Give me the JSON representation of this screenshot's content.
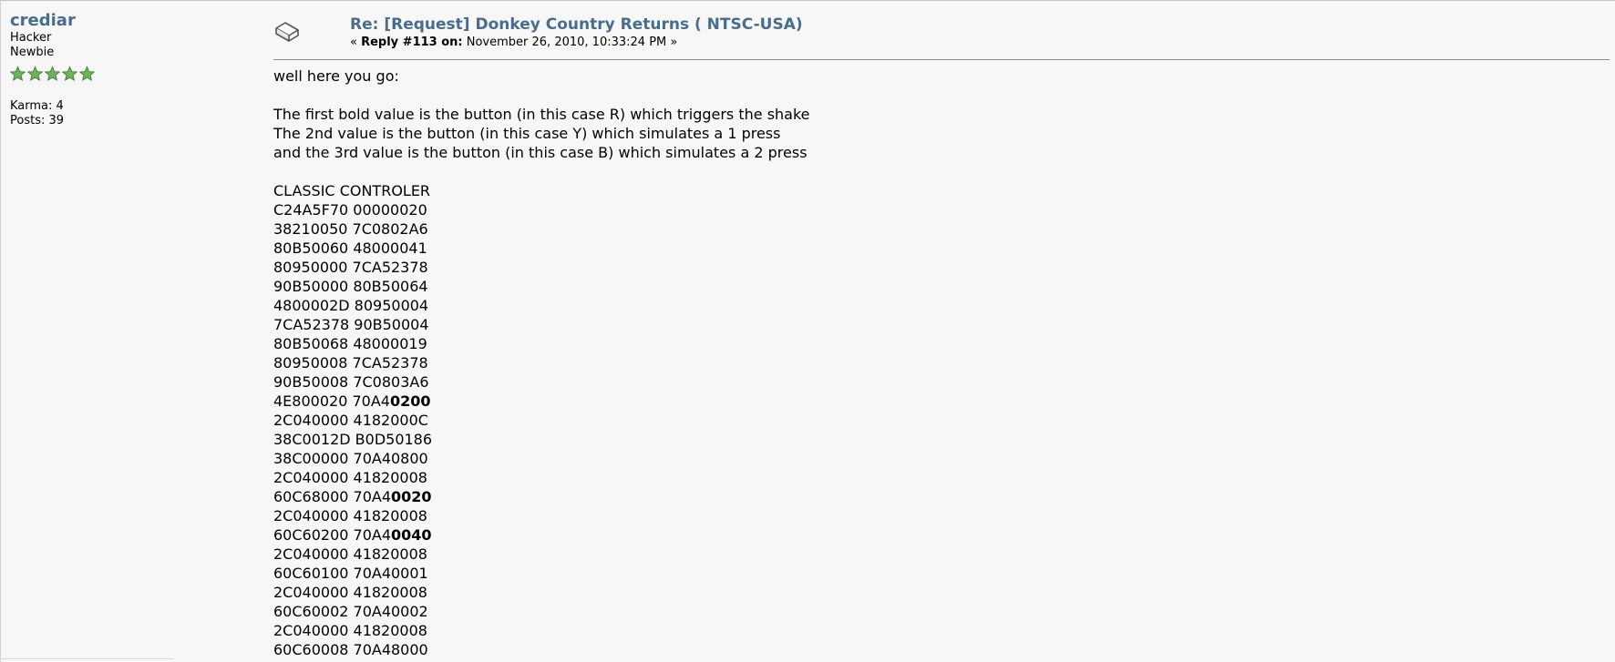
{
  "poster": {
    "name": "crediar",
    "title": "Hacker",
    "rank": "Newbie",
    "stars": 5,
    "star_icon": "star-icon",
    "karma": "Karma: 4",
    "posts": "Posts: 39"
  },
  "post": {
    "icon": "xx-post-icon",
    "subject": "Re: [Request] Donkey Country Returns ( NTSC-USA)",
    "reply_prefix": "« ",
    "reply_label": "Reply #113 on:",
    "reply_date": " November 26, 2010, 10:33:24 PM »",
    "intro": "well here you go:",
    "explain": [
      "The first bold value is the button (in this case R) which triggers the shake",
      "The 2nd value is the button (in this case Y) which simulates a 1 press",
      "and the 3rd value is the button (in this case B) which simulates a 2 press"
    ],
    "code_title": "CLASSIC CONTROLER",
    "code_lines": [
      {
        "text": "C24A5F70 00000020",
        "bold": ""
      },
      {
        "text": "38210050 7C0802A6",
        "bold": ""
      },
      {
        "text": "80B50060 48000041",
        "bold": ""
      },
      {
        "text": "80950000 7CA52378",
        "bold": ""
      },
      {
        "text": "90B50000 80B50064",
        "bold": ""
      },
      {
        "text": "4800002D 80950004",
        "bold": ""
      },
      {
        "text": "7CA52378 90B50004",
        "bold": ""
      },
      {
        "text": "80B50068 48000019",
        "bold": ""
      },
      {
        "text": "80950008 7CA52378",
        "bold": ""
      },
      {
        "text": "90B50008 7C0803A6",
        "bold": ""
      },
      {
        "text": "4E800020 70A4",
        "bold": "0200"
      },
      {
        "text": "2C040000 4182000C",
        "bold": ""
      },
      {
        "text": "38C0012D B0D50186",
        "bold": ""
      },
      {
        "text": "38C00000 70A40800",
        "bold": ""
      },
      {
        "text": "2C040000 41820008",
        "bold": ""
      },
      {
        "text": "60C68000 70A4",
        "bold": "0020"
      },
      {
        "text": "2C040000 41820008",
        "bold": ""
      },
      {
        "text": "60C60200 70A4",
        "bold": "0040"
      },
      {
        "text": "2C040000 41820008",
        "bold": ""
      },
      {
        "text": "60C60100 70A40001",
        "bold": ""
      },
      {
        "text": "2C040000 41820008",
        "bold": ""
      },
      {
        "text": "60C60002 70A40002",
        "bold": ""
      },
      {
        "text": "2C040000 41820008",
        "bold": ""
      },
      {
        "text": "60C60008 70A48000",
        "bold": ""
      }
    ]
  }
}
